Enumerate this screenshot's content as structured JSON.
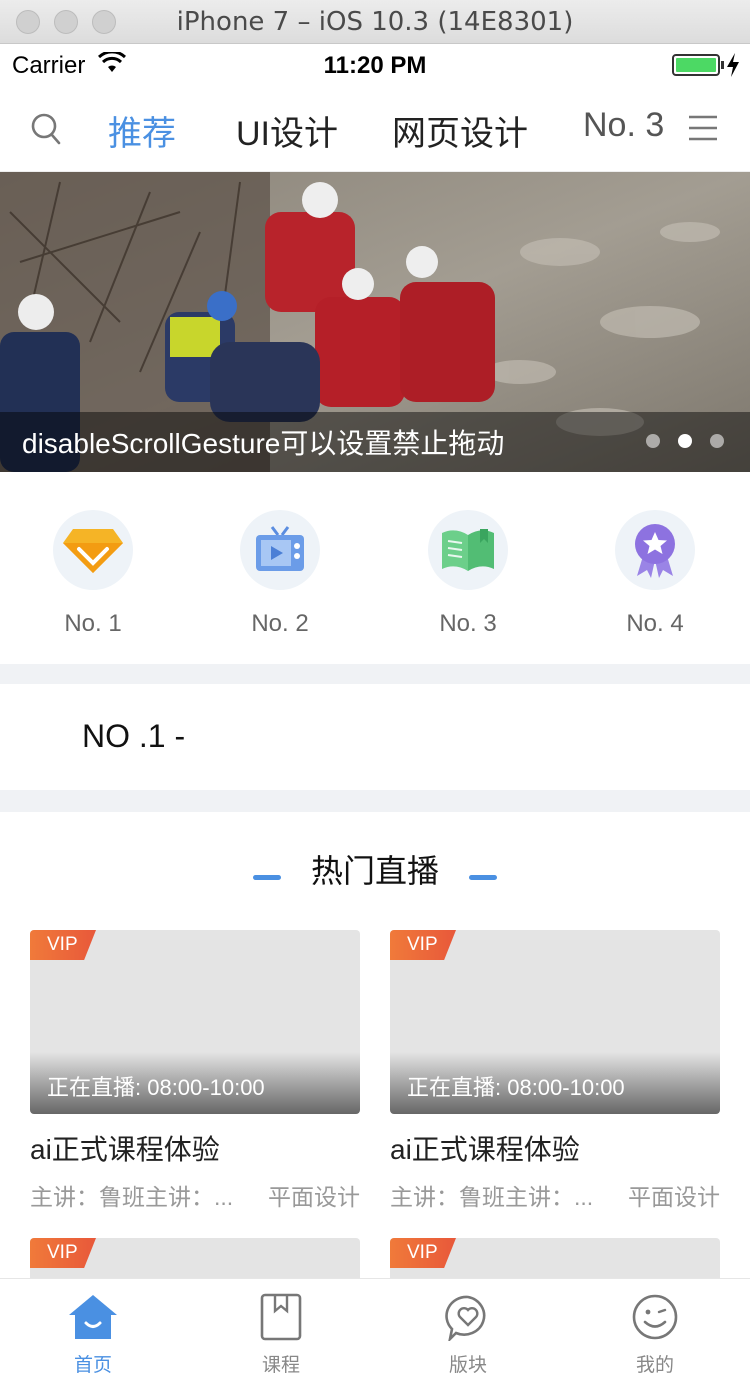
{
  "simulator": {
    "title": "iPhone 7 – iOS 10.3 (14E8301)"
  },
  "status_bar": {
    "carrier": "Carrier",
    "time": "11:20 PM"
  },
  "top_nav": {
    "tabs": [
      {
        "label": "推荐",
        "active": true
      },
      {
        "label": "UI设计",
        "active": false
      },
      {
        "label": "网页设计",
        "active": false
      },
      {
        "label": "No. 3",
        "active": false
      }
    ]
  },
  "banner": {
    "caption": "disableScrollGesture可以设置禁止拖动",
    "page_count": 3,
    "active_page": 2
  },
  "categories": [
    {
      "label": "No. 1",
      "icon": "diamond-icon"
    },
    {
      "label": "No. 2",
      "icon": "tv-icon"
    },
    {
      "label": "No. 3",
      "icon": "book-icon"
    },
    {
      "label": "No. 4",
      "icon": "badge-icon"
    }
  ],
  "notice": {
    "text": "NO .1  -"
  },
  "hot_live": {
    "title": "热门直播",
    "cards": [
      {
        "vip": "VIP",
        "live_time": "正在直播: 08:00-10:00",
        "title": "ai正式课程体验",
        "teacher": "主讲：鲁班主讲：...",
        "category": "平面设计"
      },
      {
        "vip": "VIP",
        "live_time": "正在直播: 08:00-10:00",
        "title": "ai正式课程体验",
        "teacher": "主讲：鲁班主讲：...",
        "category": "平面设计"
      },
      {
        "vip": "VIP"
      },
      {
        "vip": "VIP"
      }
    ]
  },
  "tab_bar": {
    "items": [
      {
        "label": "首页",
        "active": true
      },
      {
        "label": "课程",
        "active": false
      },
      {
        "label": "版块",
        "active": false
      },
      {
        "label": "我的",
        "active": false
      }
    ]
  },
  "colors": {
    "accent": "#4a90e2",
    "vip": "#ee6b3a",
    "battery": "#4cd964"
  }
}
